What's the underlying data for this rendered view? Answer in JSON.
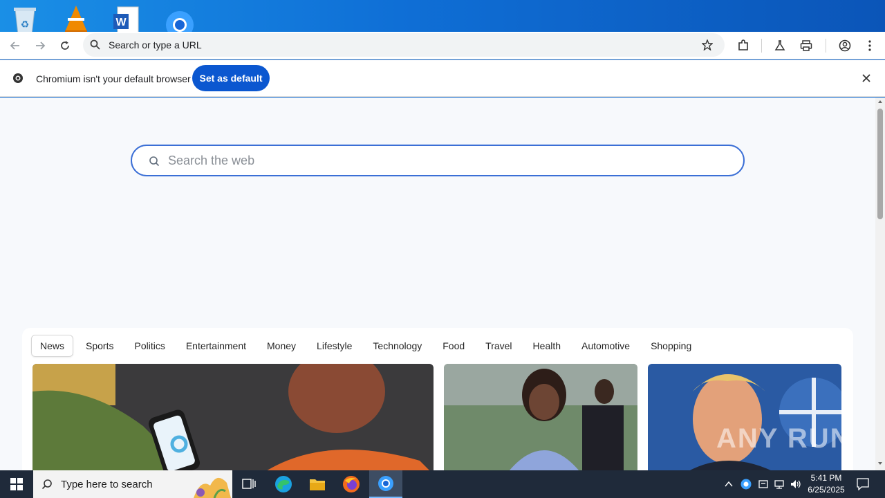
{
  "browser": {
    "omnibox_placeholder": "Search or type a URL"
  },
  "infobar": {
    "message": "Chromium isn't your default browser",
    "button_label": "Set as default"
  },
  "page": {
    "search_placeholder": "Search the web",
    "tabs": [
      "News",
      "Sports",
      "Politics",
      "Entertainment",
      "Money",
      "Lifestyle",
      "Technology",
      "Food",
      "Travel",
      "Health",
      "Automotive",
      "Shopping"
    ]
  },
  "taskbar": {
    "search_placeholder": "Type here to search",
    "time": "5:41 PM",
    "date": "6/25/2025"
  },
  "watermark": "ANY RUN",
  "colors": {
    "accent": "#0b57d0",
    "search_border": "#3b6fd6",
    "taskbar": "#1f2a3a"
  }
}
